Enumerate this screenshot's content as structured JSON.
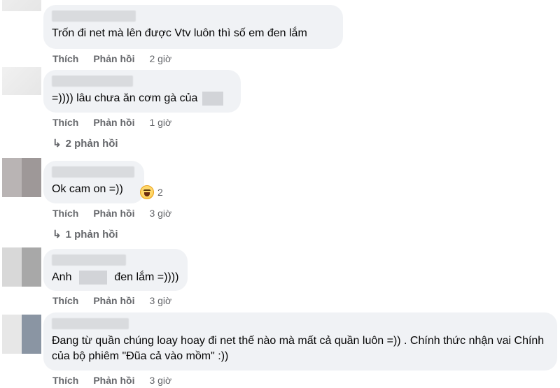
{
  "comments": [
    {
      "text": "Trốn đi net mà lên được Vtv luôn thì số em đen lắm",
      "like": "Thích",
      "reply": "Phản hồi",
      "time": "2 giờ"
    },
    {
      "text_before": "=)))) lâu chưa ăn cơm gà của",
      "like": "Thích",
      "reply": "Phản hồi",
      "time": "1 giờ",
      "replies_label": "2 phản hồi"
    },
    {
      "text": "Ok cam on =))",
      "reaction_icon": "haha-emoji-icon",
      "reaction_count": "2",
      "like": "Thích",
      "reply": "Phản hồi",
      "time": "3 giờ",
      "replies_label": "1 phản hồi"
    },
    {
      "text_before": "Anh",
      "text_after": "đen lắm =))))",
      "like": "Thích",
      "reply": "Phản hồi",
      "time": "3 giờ"
    },
    {
      "text": "Đang từ quần chúng loay hoay đi net thế nào mà mất cả quần luôn =)) . Chính thức nhận vai Chính của bộ phiêm \"Đũa cả vào mồm\" :))",
      "like": "Thích",
      "reply": "Phản hồi",
      "time": "3 giờ"
    }
  ],
  "icons": {
    "reply_arrow": "reply-arrow-icon"
  }
}
